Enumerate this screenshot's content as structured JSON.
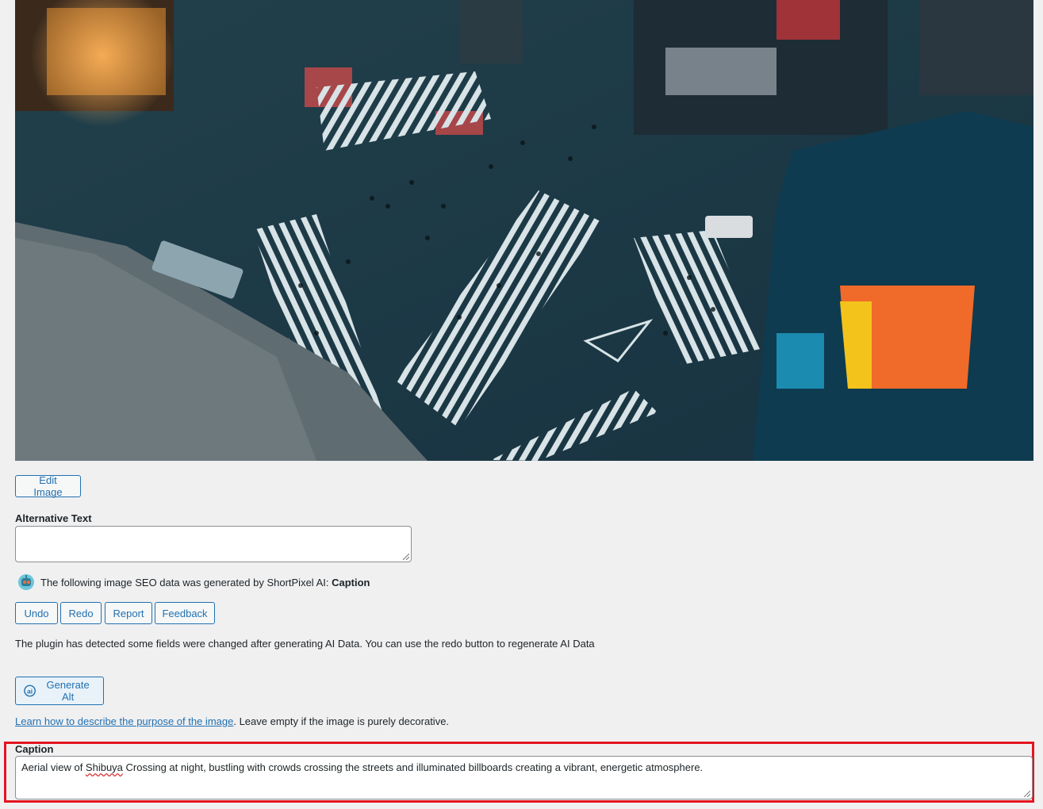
{
  "image": {
    "icon": "aerial-crossing-photo"
  },
  "buttons": {
    "edit_image": "Edit Image",
    "undo": "Undo",
    "redo": "Redo",
    "report": "Report",
    "feedback": "Feedback",
    "generate_alt": "Generate Alt"
  },
  "alt_text": {
    "label": "Alternative Text",
    "value": ""
  },
  "shortpixel": {
    "icon": "shortpixel-robot-icon",
    "notice_prefix": "The following image SEO data was generated by ShortPixel AI: ",
    "notice_field": "Caption",
    "changed_notice": "The plugin has detected some fields were changed after generating AI Data. You can use the redo button to regenerate AI Data"
  },
  "help": {
    "link_text": "Learn how to describe the purpose of the image",
    "suffix": ". Leave empty if the image is purely decorative."
  },
  "caption": {
    "label": "Caption",
    "value_before": "Aerial view of ",
    "value_flagged": "Shibuya",
    "value_after": " Crossing at night, bustling with crowds crossing the streets and illuminated billboards creating a vibrant, energetic atmosphere."
  },
  "colors": {
    "accent": "#2271b1",
    "highlight": "#e3151f",
    "background": "#f0f0f1"
  }
}
